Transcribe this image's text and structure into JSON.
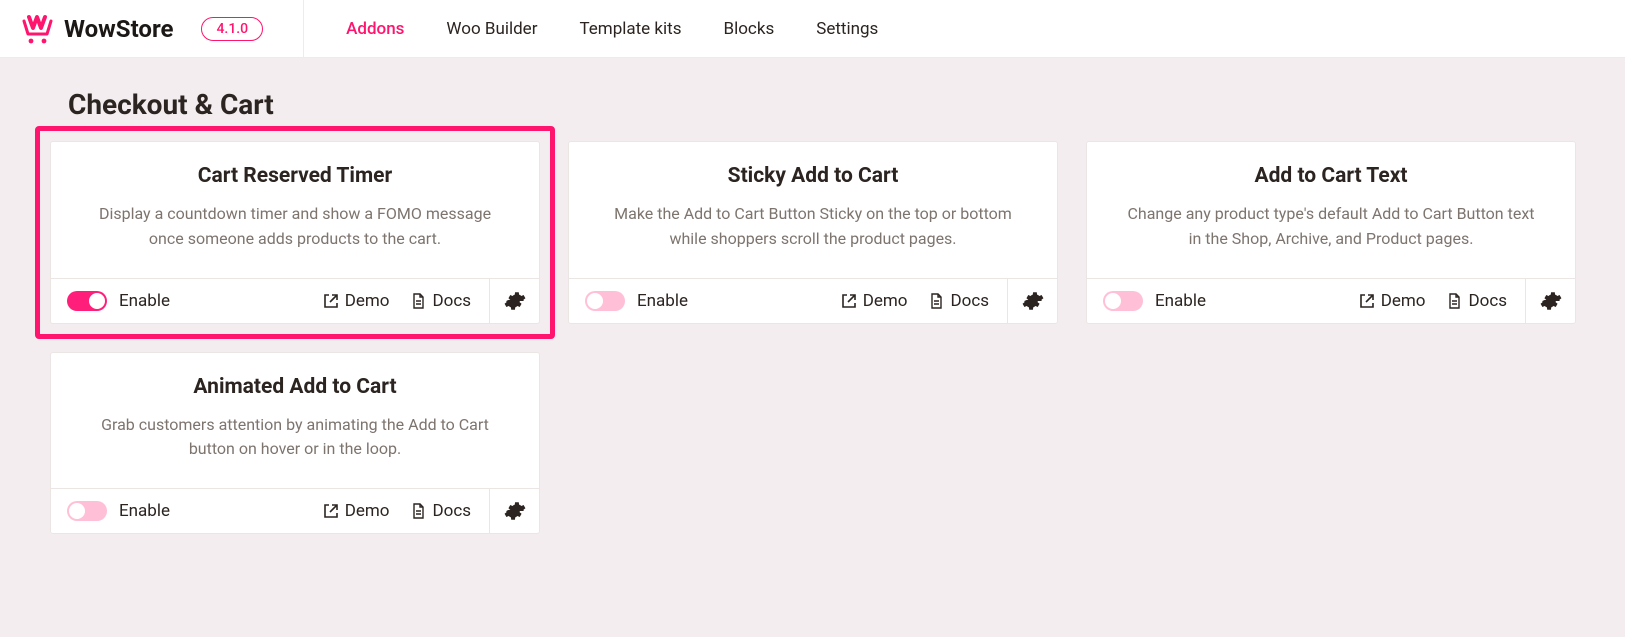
{
  "brand": {
    "name": "WowStore",
    "version": "4.1.0"
  },
  "nav": {
    "items": [
      {
        "label": "Addons",
        "active": true
      },
      {
        "label": "Woo Builder",
        "active": false
      },
      {
        "label": "Template kits",
        "active": false
      },
      {
        "label": "Blocks",
        "active": false
      },
      {
        "label": "Settings",
        "active": false
      }
    ]
  },
  "section": {
    "title": "Checkout & Cart"
  },
  "labels": {
    "enable": "Enable",
    "demo": "Demo",
    "docs": "Docs"
  },
  "cards": [
    {
      "id": "cart-reserved-timer",
      "title": "Cart Reserved Timer",
      "desc": "Display a countdown timer and show a FOMO message once someone adds products to the cart.",
      "enabled": true,
      "highlighted": true
    },
    {
      "id": "sticky-add-to-cart",
      "title": "Sticky Add to Cart",
      "desc": "Make the Add to Cart Button Sticky on the top or bottom while shoppers scroll the product pages.",
      "enabled": false,
      "highlighted": false
    },
    {
      "id": "add-to-cart-text",
      "title": "Add to Cart Text",
      "desc": "Change any product type's default Add to Cart Button text in the Shop, Archive, and Product pages.",
      "enabled": false,
      "highlighted": false
    },
    {
      "id": "animated-add-to-cart",
      "title": "Animated Add to Cart",
      "desc": "Grab customers attention by animating the Add to Cart button on hover or in the loop.",
      "enabled": false,
      "highlighted": false
    }
  ]
}
